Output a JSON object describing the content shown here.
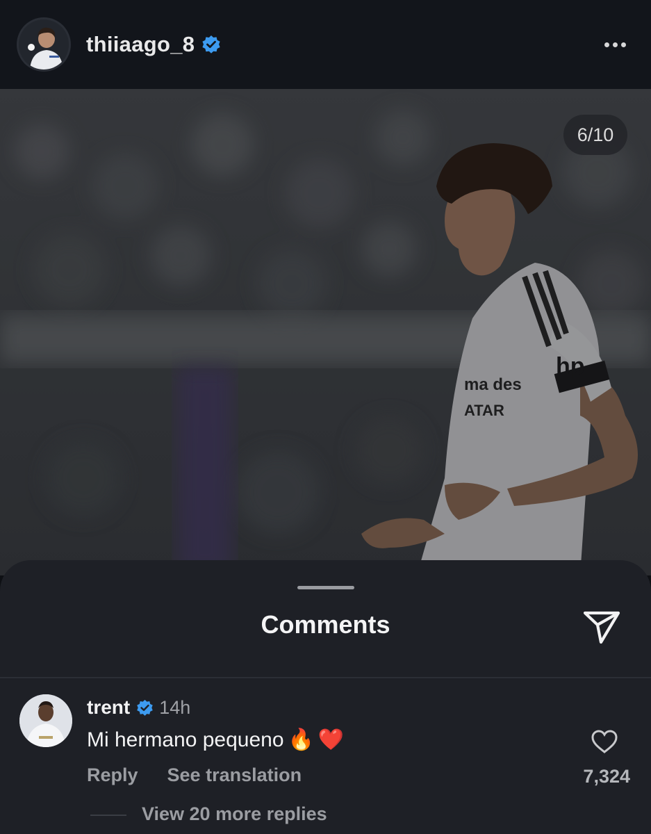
{
  "post": {
    "username": "thiiaago_8",
    "verified": true,
    "more_icon": "ellipsis-icon",
    "image_counter": "6/10"
  },
  "comments_sheet": {
    "title": "Comments",
    "share_icon": "send-icon"
  },
  "comment": {
    "username": "trent",
    "verified": true,
    "time": "14h",
    "text": "Mi hermano pequeno",
    "emojis": [
      "🔥",
      "❤️"
    ],
    "reply_label": "Reply",
    "translate_label": "See translation",
    "like_icon": "heart-outline-icon",
    "like_count": "7,324",
    "view_replies_label": "View 20 more replies"
  },
  "colors": {
    "background": "#0e1014",
    "sheet": "#1e2026",
    "verified_blue": "#3d9bf0",
    "muted_text": "#9b9da2"
  }
}
